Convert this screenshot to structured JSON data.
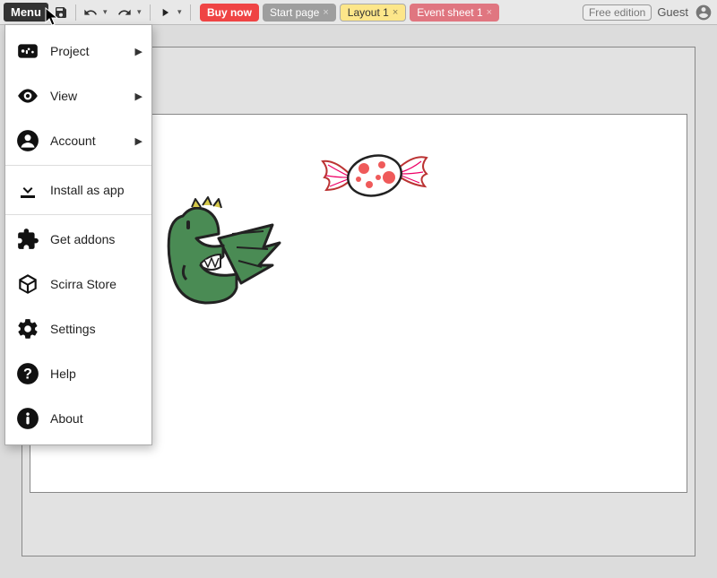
{
  "toolbar": {
    "menu_label": "Menu"
  },
  "tabs": {
    "buy": "Buy now",
    "start": "Start page",
    "layout": "Layout 1",
    "event": "Event sheet 1"
  },
  "account": {
    "free_label": "Free edition",
    "guest_label": "Guest"
  },
  "menu": {
    "project": "Project",
    "view": "View",
    "account": "Account",
    "install": "Install as app",
    "addons": "Get addons",
    "store": "Scirra Store",
    "settings": "Settings",
    "help": "Help",
    "about": "About"
  }
}
